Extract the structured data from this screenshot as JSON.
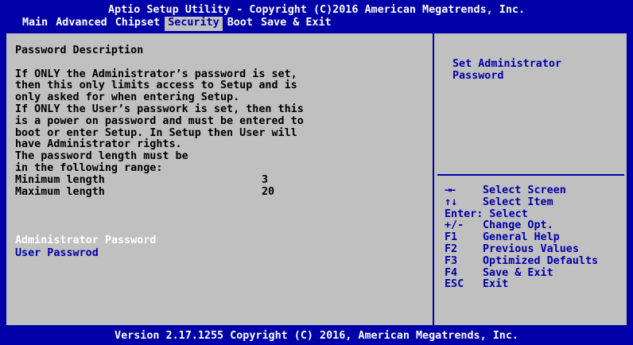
{
  "header": {
    "title": "Aptio Setup Utility - Copyright (C)2016 American Megatrends, Inc.",
    "tabs": [
      "Main",
      "Advanced",
      "Chipset",
      "Security",
      "Boot",
      "Save & Exit"
    ],
    "active_tab": "Security"
  },
  "main": {
    "heading": "Password Description",
    "description": [
      "If ONLY the Administrator’s password is set,",
      "then this only limits access to Setup and is",
      "only asked for when entering Setup.",
      "If ONLY the User’s passwork is set, then this",
      "is a power on password and must be entered to",
      "boot or enter Setup. In Setup then User will",
      "have Administrator rights.",
      "The password length must be",
      "in the following range:"
    ],
    "min_label": "Minimum length",
    "min_value": "3",
    "max_label": "Maximum length",
    "max_value": "20",
    "items": [
      {
        "label": "Administrator Password",
        "selected": true
      },
      {
        "label": "User Passwrod",
        "selected": false
      }
    ]
  },
  "help": {
    "line1": "Set Administrator",
    "line2": "Password"
  },
  "keys": [
    {
      "key": "→←",
      "desc": "Select Screen"
    },
    {
      "key": "↑↓",
      "desc": "Select Item"
    },
    {
      "key": "",
      "desc": "Enter: Select"
    },
    {
      "key": "+/-",
      "desc": "Change Opt."
    },
    {
      "key": "F1",
      "desc": "General Help"
    },
    {
      "key": "F2",
      "desc": "Previous Values"
    },
    {
      "key": "F3",
      "desc": "Optimized Defaults"
    },
    {
      "key": "F4",
      "desc": "Save & Exit"
    },
    {
      "key": "ESC",
      "desc": "Exit"
    }
  ],
  "footer": "Version 2.17.1255 Copyright (C) 2016, American Megatrends, Inc.",
  "colors": {
    "background": "#0000a8",
    "panel": "#c0c0c0",
    "text_dark": "#000000",
    "text_blue": "#0000a8",
    "text_white": "#ffffff"
  }
}
